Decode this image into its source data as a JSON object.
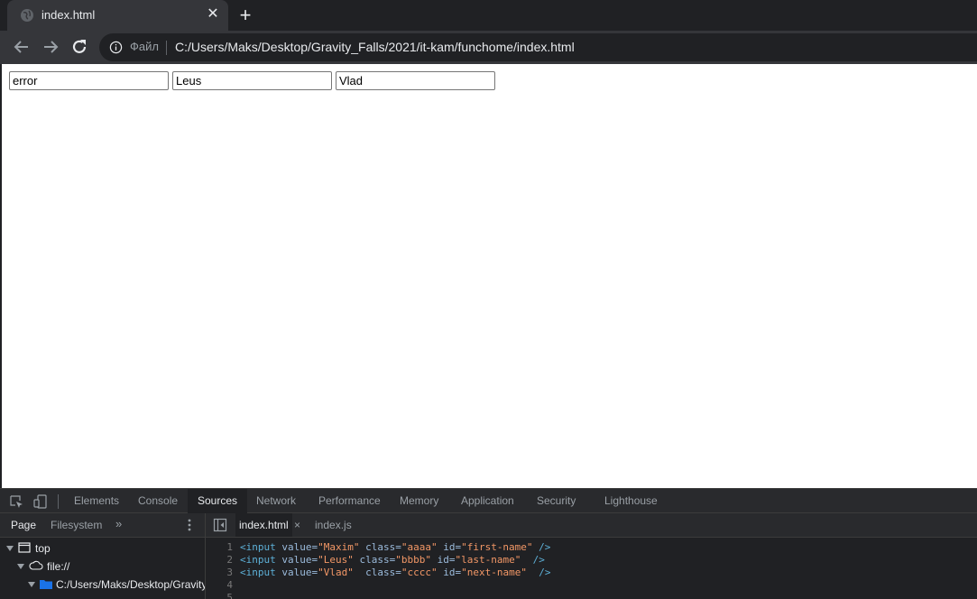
{
  "browser": {
    "tab": {
      "title": "index.html"
    },
    "omnibox": {
      "scheme_label": "Файл",
      "url": "C:/Users/Maks/Desktop/Gravity_Falls/2021/it-kam/funchome/index.html"
    }
  },
  "page": {
    "inputs": [
      {
        "value": "error"
      },
      {
        "value": "Leus"
      },
      {
        "value": "Vlad"
      }
    ]
  },
  "devtools": {
    "tabs": [
      {
        "label": "Elements"
      },
      {
        "label": "Console"
      },
      {
        "label": "Sources"
      },
      {
        "label": "Network"
      },
      {
        "label": "Performance"
      },
      {
        "label": "Memory"
      },
      {
        "label": "Application"
      },
      {
        "label": "Security"
      },
      {
        "label": "Lighthouse"
      }
    ],
    "active_tab": "Sources",
    "navigator": {
      "tabs": [
        {
          "label": "Page"
        },
        {
          "label": "Filesystem"
        }
      ],
      "more_label": "»",
      "tree": [
        {
          "label": "top"
        },
        {
          "label": "file://"
        },
        {
          "label": "C:/Users/Maks/Desktop/Gravity"
        }
      ]
    },
    "editor": {
      "files": [
        {
          "label": "index.html"
        },
        {
          "label": "index.js"
        }
      ],
      "close_label": "×",
      "lines": [
        {
          "n": "1",
          "tag": "<input",
          "a1": " value=",
          "v1": "\"Maxim\"",
          "a2": " class=",
          "v2": "\"aaaa\"",
          "a3": " id=",
          "v3": "\"first-name\"",
          "end": " />"
        },
        {
          "n": "2",
          "tag": "<input",
          "a1": " value=",
          "v1": "\"Leus\"",
          "a2": " class=",
          "v2": "\"bbbb\"",
          "a3": " id=",
          "v3": "\"last-name\"",
          "end": "  />"
        },
        {
          "n": "3",
          "tag": "<input",
          "a1": " value=",
          "v1": "\"Vlad\"",
          "a2": "  class=",
          "v2": "\"cccc\"",
          "a3": " id=",
          "v3": "\"next-name\"",
          "end": "  />"
        },
        {
          "n": "4"
        },
        {
          "n": "5"
        }
      ]
    }
  }
}
